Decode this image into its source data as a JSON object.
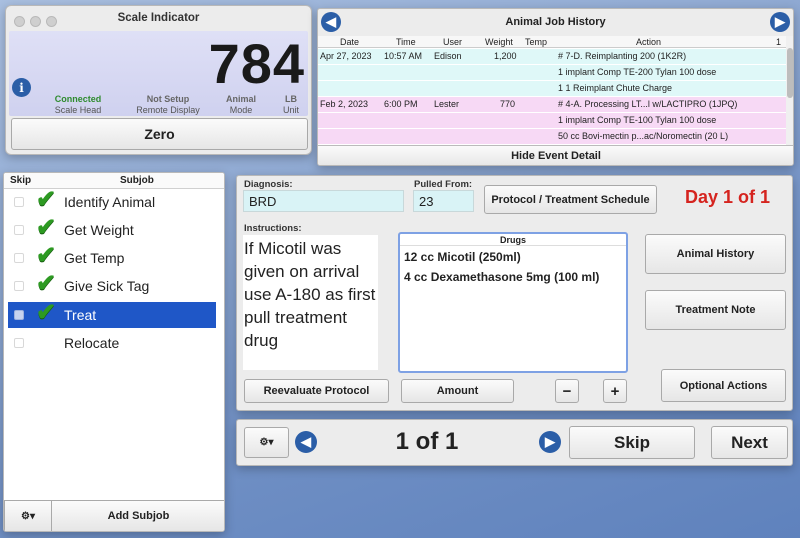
{
  "scale": {
    "title": "Scale Indicator",
    "reading": "784",
    "info_icon": "info-icon",
    "status": [
      {
        "value": "Connected",
        "label": "Scale Head",
        "color": "#2e8b2e"
      },
      {
        "value": "Not Setup",
        "label": "Remote Display",
        "color": "#555555"
      },
      {
        "value": "Animal",
        "label": "Mode",
        "color": "#555555"
      },
      {
        "value": "LB",
        "label": "Unit",
        "color": "#555555"
      }
    ],
    "zero_label": "Zero"
  },
  "history": {
    "title": "Animal Job History",
    "headers": [
      "Date",
      "Time",
      "User",
      "Weight",
      "Temp",
      "Action",
      "1"
    ],
    "rows": [
      {
        "date": "Apr 27, 2023",
        "time": "10:57 AM",
        "user": "Edison",
        "weight": "1,200",
        "temp": "",
        "action": "# 7-D. Reimplanting 200 (1K2R)"
      },
      {
        "action": "1 implant Comp TE-200 Tylan 100 dose"
      },
      {
        "action": "1 1 Reimplant Chute Charge"
      },
      {
        "date": "Feb 2, 2023",
        "time": "6:00 PM",
        "user": "Lester",
        "weight": "770",
        "temp": "",
        "action": "# 4-A. Processing LT...l w/LACTIPRO (1JPQ)"
      },
      {
        "action": "1 implant Comp TE-100 Tylan 100 dose"
      },
      {
        "action": "50 cc Bovi-mectin p...ac/Noromectin (20 L)"
      }
    ],
    "hide_label": "Hide Event Detail",
    "colors": {
      "row_a": "#dff8f8",
      "row_b": "#f7d9f5"
    }
  },
  "subjobs": {
    "header_skip": "Skip",
    "header_subjob": "Subjob",
    "items": [
      {
        "label": "Identify Animal",
        "done": true
      },
      {
        "label": "Get Weight",
        "done": true
      },
      {
        "label": "Get Temp",
        "done": true
      },
      {
        "label": "Give Sick Tag",
        "done": true
      },
      {
        "label": "Treat",
        "done": true,
        "selected": true
      },
      {
        "label": "Relocate",
        "done": false
      }
    ],
    "add_label": "Add Subjob",
    "gear": "⚙▾"
  },
  "treat": {
    "diagnosis_label": "Diagnosis:",
    "diagnosis": "BRD",
    "pulled_label": "Pulled From:",
    "pulled": "23",
    "protocol_btn": "Protocol / Treatment Schedule",
    "day": "Day 1 of 1",
    "instructions_label": "Instructions:",
    "instructions": "If Micotil was given on arrival use A-180 as first pull treatment drug",
    "drugs_header": "Drugs",
    "drugs": [
      "12 cc Micotil (250ml)",
      "4 cc Dexamethasone 5mg (100 ml)"
    ],
    "animal_history": "Animal History",
    "treatment_note": "Treatment Note",
    "optional_actions": "Optional Actions",
    "reevaluate": "Reevaluate Protocol",
    "amount": "Amount",
    "minus": "−",
    "plus": "+"
  },
  "nav": {
    "gear": "⚙▾",
    "counter": "1 of 1",
    "skip": "Skip",
    "next": "Next"
  }
}
